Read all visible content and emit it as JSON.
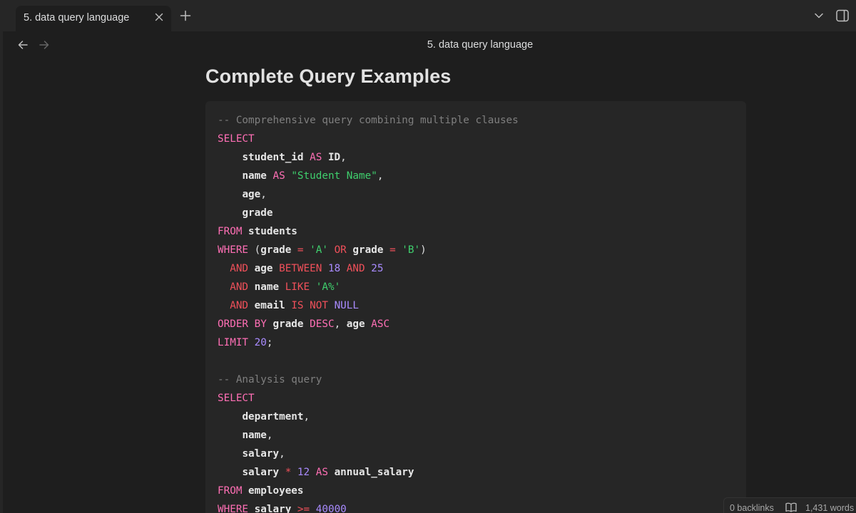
{
  "tab": {
    "title": "5. data query language"
  },
  "view": {
    "title": "5. data query language"
  },
  "note": {
    "heading": "Complete Query Examples",
    "code_lines": [
      [
        {
          "t": "comment",
          "s": "-- Comprehensive query combining multiple clauses"
        }
      ],
      [
        {
          "t": "keyword",
          "s": "SELECT"
        }
      ],
      [
        {
          "t": "plain",
          "s": "    "
        },
        {
          "t": "ident",
          "s": "student_id"
        },
        {
          "t": "plain",
          "s": " "
        },
        {
          "t": "keyword",
          "s": "AS"
        },
        {
          "t": "plain",
          "s": " "
        },
        {
          "t": "ident",
          "s": "ID"
        },
        {
          "t": "plain",
          "s": ","
        }
      ],
      [
        {
          "t": "plain",
          "s": "    "
        },
        {
          "t": "ident",
          "s": "name"
        },
        {
          "t": "plain",
          "s": " "
        },
        {
          "t": "keyword",
          "s": "AS"
        },
        {
          "t": "plain",
          "s": " "
        },
        {
          "t": "string",
          "s": "\"Student Name\""
        },
        {
          "t": "plain",
          "s": ","
        }
      ],
      [
        {
          "t": "plain",
          "s": "    "
        },
        {
          "t": "ident",
          "s": "age"
        },
        {
          "t": "plain",
          "s": ","
        }
      ],
      [
        {
          "t": "plain",
          "s": "    "
        },
        {
          "t": "ident",
          "s": "grade"
        }
      ],
      [
        {
          "t": "keyword",
          "s": "FROM"
        },
        {
          "t": "plain",
          "s": " "
        },
        {
          "t": "ident",
          "s": "students"
        }
      ],
      [
        {
          "t": "keyword",
          "s": "WHERE"
        },
        {
          "t": "plain",
          "s": " ("
        },
        {
          "t": "ident",
          "s": "grade"
        },
        {
          "t": "plain",
          "s": " "
        },
        {
          "t": "op",
          "s": "="
        },
        {
          "t": "plain",
          "s": " "
        },
        {
          "t": "string",
          "s": "'A'"
        },
        {
          "t": "plain",
          "s": " "
        },
        {
          "t": "op",
          "s": "OR"
        },
        {
          "t": "plain",
          "s": " "
        },
        {
          "t": "ident",
          "s": "grade"
        },
        {
          "t": "plain",
          "s": " "
        },
        {
          "t": "op",
          "s": "="
        },
        {
          "t": "plain",
          "s": " "
        },
        {
          "t": "string",
          "s": "'B'"
        },
        {
          "t": "plain",
          "s": ")"
        }
      ],
      [
        {
          "t": "plain",
          "s": "  "
        },
        {
          "t": "op",
          "s": "AND"
        },
        {
          "t": "plain",
          "s": " "
        },
        {
          "t": "ident",
          "s": "age"
        },
        {
          "t": "plain",
          "s": " "
        },
        {
          "t": "op",
          "s": "BETWEEN"
        },
        {
          "t": "plain",
          "s": " "
        },
        {
          "t": "number",
          "s": "18"
        },
        {
          "t": "plain",
          "s": " "
        },
        {
          "t": "op",
          "s": "AND"
        },
        {
          "t": "plain",
          "s": " "
        },
        {
          "t": "number",
          "s": "25"
        }
      ],
      [
        {
          "t": "plain",
          "s": "  "
        },
        {
          "t": "op",
          "s": "AND"
        },
        {
          "t": "plain",
          "s": " "
        },
        {
          "t": "ident",
          "s": "name"
        },
        {
          "t": "plain",
          "s": " "
        },
        {
          "t": "op",
          "s": "LIKE"
        },
        {
          "t": "plain",
          "s": " "
        },
        {
          "t": "string",
          "s": "'A%'"
        }
      ],
      [
        {
          "t": "plain",
          "s": "  "
        },
        {
          "t": "op",
          "s": "AND"
        },
        {
          "t": "plain",
          "s": " "
        },
        {
          "t": "ident",
          "s": "email"
        },
        {
          "t": "plain",
          "s": " "
        },
        {
          "t": "op",
          "s": "IS"
        },
        {
          "t": "plain",
          "s": " "
        },
        {
          "t": "op",
          "s": "NOT"
        },
        {
          "t": "plain",
          "s": " "
        },
        {
          "t": "number",
          "s": "NULL"
        }
      ],
      [
        {
          "t": "keyword",
          "s": "ORDER BY"
        },
        {
          "t": "plain",
          "s": " "
        },
        {
          "t": "ident",
          "s": "grade"
        },
        {
          "t": "plain",
          "s": " "
        },
        {
          "t": "keyword",
          "s": "DESC"
        },
        {
          "t": "plain",
          "s": ", "
        },
        {
          "t": "ident",
          "s": "age"
        },
        {
          "t": "plain",
          "s": " "
        },
        {
          "t": "keyword",
          "s": "ASC"
        }
      ],
      [
        {
          "t": "keyword",
          "s": "LIMIT"
        },
        {
          "t": "plain",
          "s": " "
        },
        {
          "t": "number",
          "s": "20"
        },
        {
          "t": "plain",
          "s": ";"
        }
      ],
      [
        {
          "t": "plain",
          "s": ""
        }
      ],
      [
        {
          "t": "comment",
          "s": "-- Analysis query"
        }
      ],
      [
        {
          "t": "keyword",
          "s": "SELECT"
        }
      ],
      [
        {
          "t": "plain",
          "s": "    "
        },
        {
          "t": "ident",
          "s": "department"
        },
        {
          "t": "plain",
          "s": ","
        }
      ],
      [
        {
          "t": "plain",
          "s": "    "
        },
        {
          "t": "ident",
          "s": "name"
        },
        {
          "t": "plain",
          "s": ","
        }
      ],
      [
        {
          "t": "plain",
          "s": "    "
        },
        {
          "t": "ident",
          "s": "salary"
        },
        {
          "t": "plain",
          "s": ","
        }
      ],
      [
        {
          "t": "plain",
          "s": "    "
        },
        {
          "t": "ident",
          "s": "salary"
        },
        {
          "t": "plain",
          "s": " "
        },
        {
          "t": "op",
          "s": "*"
        },
        {
          "t": "plain",
          "s": " "
        },
        {
          "t": "number",
          "s": "12"
        },
        {
          "t": "plain",
          "s": " "
        },
        {
          "t": "keyword",
          "s": "AS"
        },
        {
          "t": "plain",
          "s": " "
        },
        {
          "t": "ident",
          "s": "annual_salary"
        }
      ],
      [
        {
          "t": "keyword",
          "s": "FROM"
        },
        {
          "t": "plain",
          "s": " "
        },
        {
          "t": "ident",
          "s": "employees"
        }
      ],
      [
        {
          "t": "keyword",
          "s": "WHERE"
        },
        {
          "t": "plain",
          "s": " "
        },
        {
          "t": "ident",
          "s": "salary"
        },
        {
          "t": "plain",
          "s": " "
        },
        {
          "t": "op",
          "s": ">="
        },
        {
          "t": "plain",
          "s": " "
        },
        {
          "t": "number",
          "s": "40000"
        }
      ]
    ]
  },
  "status_bar": {
    "backlinks": "0 backlinks",
    "word_count": "1,431 words"
  },
  "icons": {
    "close": "close-icon",
    "new_tab": "plus-icon",
    "tab_list": "chevron-down-icon",
    "sidebar_toggle": "sidebar-toggle-icon",
    "back": "arrow-left-icon",
    "forward": "arrow-right-icon",
    "reading_mode": "book-open-icon"
  },
  "colors": {
    "background": "#1e1e1e",
    "tab_bar": "#262626",
    "code_background": "#262626",
    "keyword": "#ff6fb5",
    "operator": "#f0505a",
    "string": "#3fcf6d",
    "number": "#a98bff",
    "comment": "#7f7f7f"
  }
}
